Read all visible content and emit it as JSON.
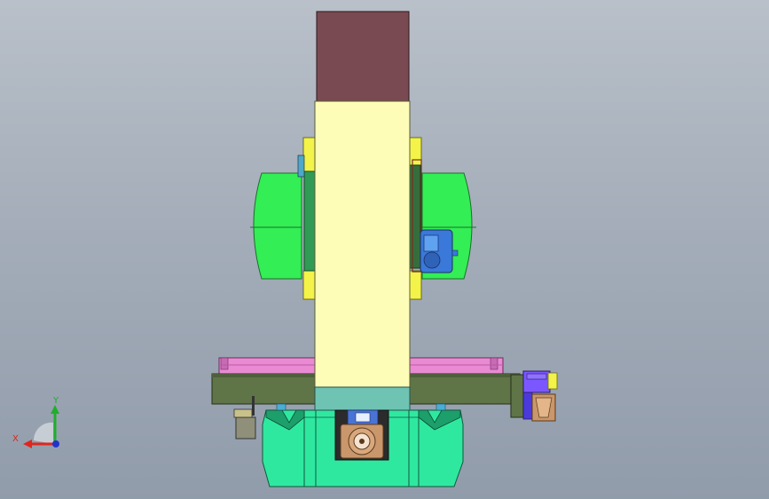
{
  "view": {
    "background_top": "#b9c0c9",
    "background_bottom": "#919cab"
  },
  "triad": {
    "x_label": "X",
    "y_label": "Y",
    "x_color": "#e0261c",
    "y_color": "#1fae2c",
    "z_color": "#2233cc"
  },
  "parts": {
    "spindle_head_color": "#7a4a52",
    "column_color": "#fdfdb8",
    "column_base_color": "#6fc3b3",
    "rotary_arm_color": "#33ee55",
    "bracket_color": "#f3f34a",
    "motor_color": "#3a78d9",
    "table_color": "#5f7447",
    "table_rail_color": "#e98ad3",
    "base_color": "#2fe8a0",
    "servo_color": "#7b57ff",
    "bearing_color": "#c9976b"
  }
}
